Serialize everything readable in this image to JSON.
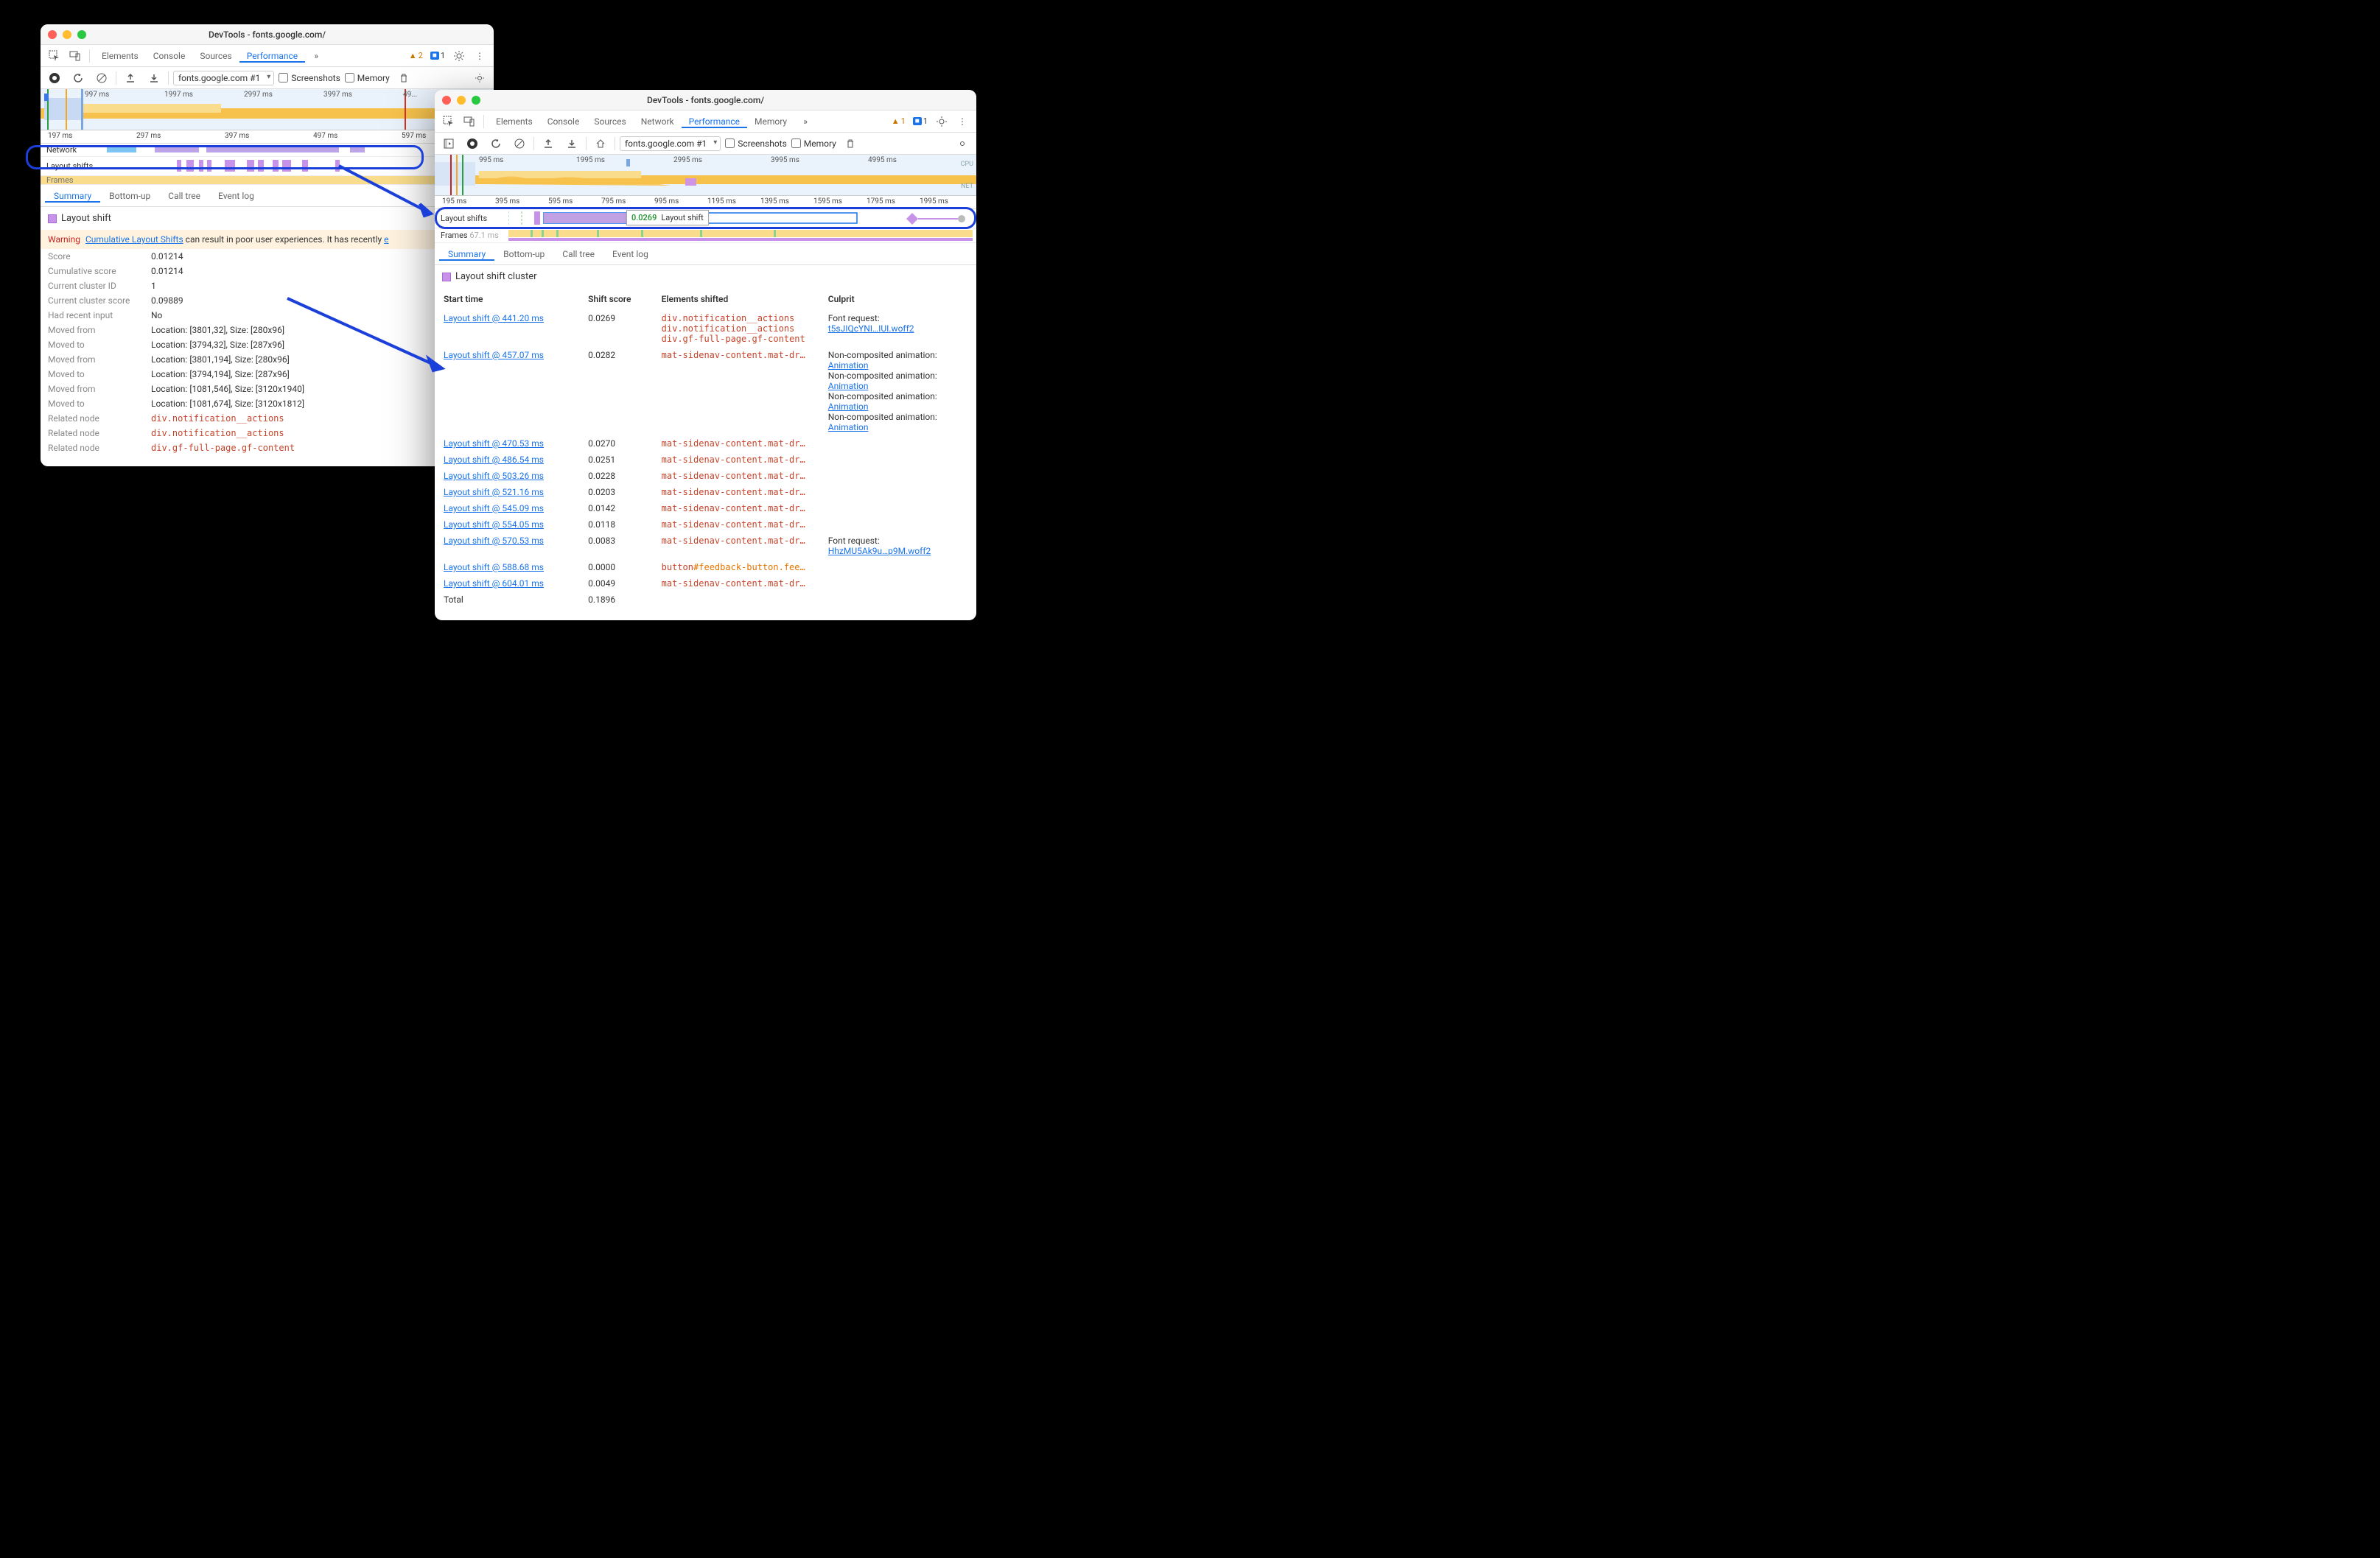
{
  "left": {
    "title": "DevTools - fonts.google.com/",
    "tabs": [
      "Elements",
      "Console",
      "Sources",
      "Performance"
    ],
    "active_tab": "Performance",
    "warn_count": "2",
    "issue_count": "1",
    "recording_name": "fonts.google.com #1",
    "screenshots_label": "Screenshots",
    "memory_label": "Memory",
    "mini_ticks": [
      "997 ms",
      "1997 ms",
      "2997 ms",
      "3997 ms",
      "49..."
    ],
    "ruler_ticks": [
      "197 ms",
      "297 ms",
      "397 ms",
      "497 ms",
      "597 ms"
    ],
    "network_label": "Network",
    "frames_label": "Frames",
    "layout_shifts_label": "Layout shifts",
    "sub_tabs": [
      "Summary",
      "Bottom-up",
      "Call tree",
      "Event log"
    ],
    "active_sub": "Summary",
    "section_title": "Layout shift",
    "warning_label": "Warning",
    "warning_link_text": "Cumulative Layout Shifts",
    "warning_text": " can result in poor user experiences. It has recently ",
    "details": [
      {
        "k": "Score",
        "v": "0.01214"
      },
      {
        "k": "Cumulative score",
        "v": "0.01214"
      },
      {
        "k": "Current cluster ID",
        "v": "1"
      },
      {
        "k": "Current cluster score",
        "v": "0.09889"
      },
      {
        "k": "Had recent input",
        "v": "No"
      },
      {
        "k": "Moved from",
        "v": "Location: [3801,32], Size: [280x96]"
      },
      {
        "k": "Moved to",
        "v": "Location: [3794,32], Size: [287x96]"
      },
      {
        "k": "Moved from",
        "v": "Location: [3801,194], Size: [280x96]"
      },
      {
        "k": "Moved to",
        "v": "Location: [3794,194], Size: [287x96]"
      },
      {
        "k": "Moved from",
        "v": "Location: [1081,546], Size: [3120x1940]"
      },
      {
        "k": "Moved to",
        "v": "Location: [1081,674], Size: [3120x1812]"
      }
    ],
    "related_nodes": [
      {
        "text": "div.notification__actions"
      },
      {
        "text": "div.notification__actions"
      },
      {
        "text": "div.gf-full-page.gf-content"
      }
    ],
    "related_label": "Related node"
  },
  "right": {
    "title": "DevTools - fonts.google.com/",
    "tabs": [
      "Elements",
      "Console",
      "Sources",
      "Network",
      "Performance",
      "Memory"
    ],
    "active_tab": "Performance",
    "warn_count": "1",
    "issue_count": "1",
    "recording_name": "fonts.google.com #1",
    "screenshots_label": "Screenshots",
    "memory_label": "Memory",
    "mini_ticks": [
      "995 ms",
      "1995 ms",
      "2995 ms",
      "3995 ms",
      "4995 ms"
    ],
    "ruler_ticks": [
      "195 ms",
      "395 ms",
      "595 ms",
      "795 ms",
      "995 ms",
      "1195 ms",
      "1395 ms",
      "1595 ms",
      "1795 ms",
      "1995 ms"
    ],
    "layout_shifts_label": "Layout shifts",
    "frames_label": "Frames",
    "frame_time": "67.1 ms",
    "cpu_label": "CPU",
    "net_label": "NET",
    "tooltip_value": "0.0269",
    "tooltip_text": "Layout shift",
    "sub_tabs": [
      "Summary",
      "Bottom-up",
      "Call tree",
      "Event log"
    ],
    "active_sub": "Summary",
    "section_title": "Layout shift cluster",
    "table_headers": [
      "Start time",
      "Shift score",
      "Elements shifted",
      "Culprit"
    ],
    "rows": [
      {
        "start": "Layout shift @ 441.20 ms",
        "score": "0.0269",
        "elements": [
          "div.notification__actions",
          "div.notification__actions",
          "div.gf-full-page.gf-content"
        ],
        "culprit": [
          {
            "label": "Font request:",
            "links": [
              "t5sJIQcYNI…IUI.woff2"
            ]
          }
        ]
      },
      {
        "start": "Layout shift @ 457.07 ms",
        "score": "0.0282",
        "elements": [
          "mat-sidenav-content.mat-dr…"
        ],
        "culprit": [
          {
            "label": "Non-composited animation:",
            "links": [
              "Animation"
            ]
          },
          {
            "label": "Non-composited animation:",
            "links": [
              "Animation"
            ]
          },
          {
            "label": "Non-composited animation:",
            "links": [
              "Animation"
            ]
          },
          {
            "label": "Non-composited animation:",
            "links": [
              "Animation"
            ]
          }
        ]
      },
      {
        "start": "Layout shift @ 470.53 ms",
        "score": "0.0270",
        "elements": [
          "mat-sidenav-content.mat-dr…"
        ],
        "culprit": []
      },
      {
        "start": "Layout shift @ 486.54 ms",
        "score": "0.0251",
        "elements": [
          "mat-sidenav-content.mat-dr…"
        ],
        "culprit": []
      },
      {
        "start": "Layout shift @ 503.26 ms",
        "score": "0.0228",
        "elements": [
          "mat-sidenav-content.mat-dr…"
        ],
        "culprit": []
      },
      {
        "start": "Layout shift @ 521.16 ms",
        "score": "0.0203",
        "elements": [
          "mat-sidenav-content.mat-dr…"
        ],
        "culprit": []
      },
      {
        "start": "Layout shift @ 545.09 ms",
        "score": "0.0142",
        "elements": [
          "mat-sidenav-content.mat-dr…"
        ],
        "culprit": []
      },
      {
        "start": "Layout shift @ 554.05 ms",
        "score": "0.0118",
        "elements": [
          "mat-sidenav-content.mat-dr…"
        ],
        "culprit": []
      },
      {
        "start": "Layout shift @ 570.53 ms",
        "score": "0.0083",
        "elements": [
          "mat-sidenav-content.mat-dr…"
        ],
        "culprit": [
          {
            "label": "Font request:",
            "links": [
              "HhzMU5Ak9u…p9M.woff2"
            ]
          }
        ]
      },
      {
        "start": "Layout shift @ 588.68 ms",
        "score": "0.0000",
        "elements": [
          "button#feedback-button.fee…"
        ],
        "culprit": [],
        "special": "button"
      },
      {
        "start": "Layout shift @ 604.01 ms",
        "score": "0.0049",
        "elements": [
          "mat-sidenav-content.mat-dr…"
        ],
        "culprit": []
      }
    ],
    "total_label": "Total",
    "total_value": "0.1896"
  }
}
